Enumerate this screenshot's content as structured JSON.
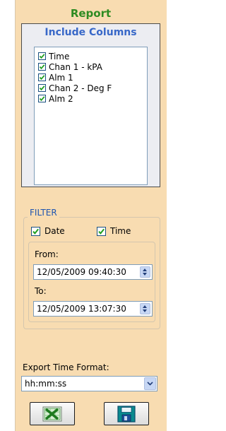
{
  "report": {
    "title": "Report"
  },
  "include_columns": {
    "title": "Include Columns",
    "items": [
      {
        "label": "Time",
        "checked": true
      },
      {
        "label": "Chan 1 - kPA",
        "checked": true
      },
      {
        "label": "Alm 1",
        "checked": true
      },
      {
        "label": "Chan 2 - Deg F",
        "checked": true
      },
      {
        "label": "Alm 2",
        "checked": true
      }
    ]
  },
  "filter": {
    "legend": "FILTER",
    "date_label": "Date",
    "date_checked": true,
    "time_label": "Time",
    "time_checked": true,
    "from_label": "From:",
    "from_value": "12/05/2009 09:40:30",
    "to_label": "To:",
    "to_value": "12/05/2009 13:07:30"
  },
  "export": {
    "label": "Export Time Format:",
    "value": "hh:mm:ss"
  },
  "buttons": {
    "excel_icon": "excel-icon",
    "save_icon": "save-icon"
  },
  "colors": {
    "panel_bg": "#f8dcb1",
    "report_title": "#2e8b22",
    "include_title": "#3868c8",
    "filter_legend": "#1f55b0",
    "check_mark": "#20a020"
  }
}
